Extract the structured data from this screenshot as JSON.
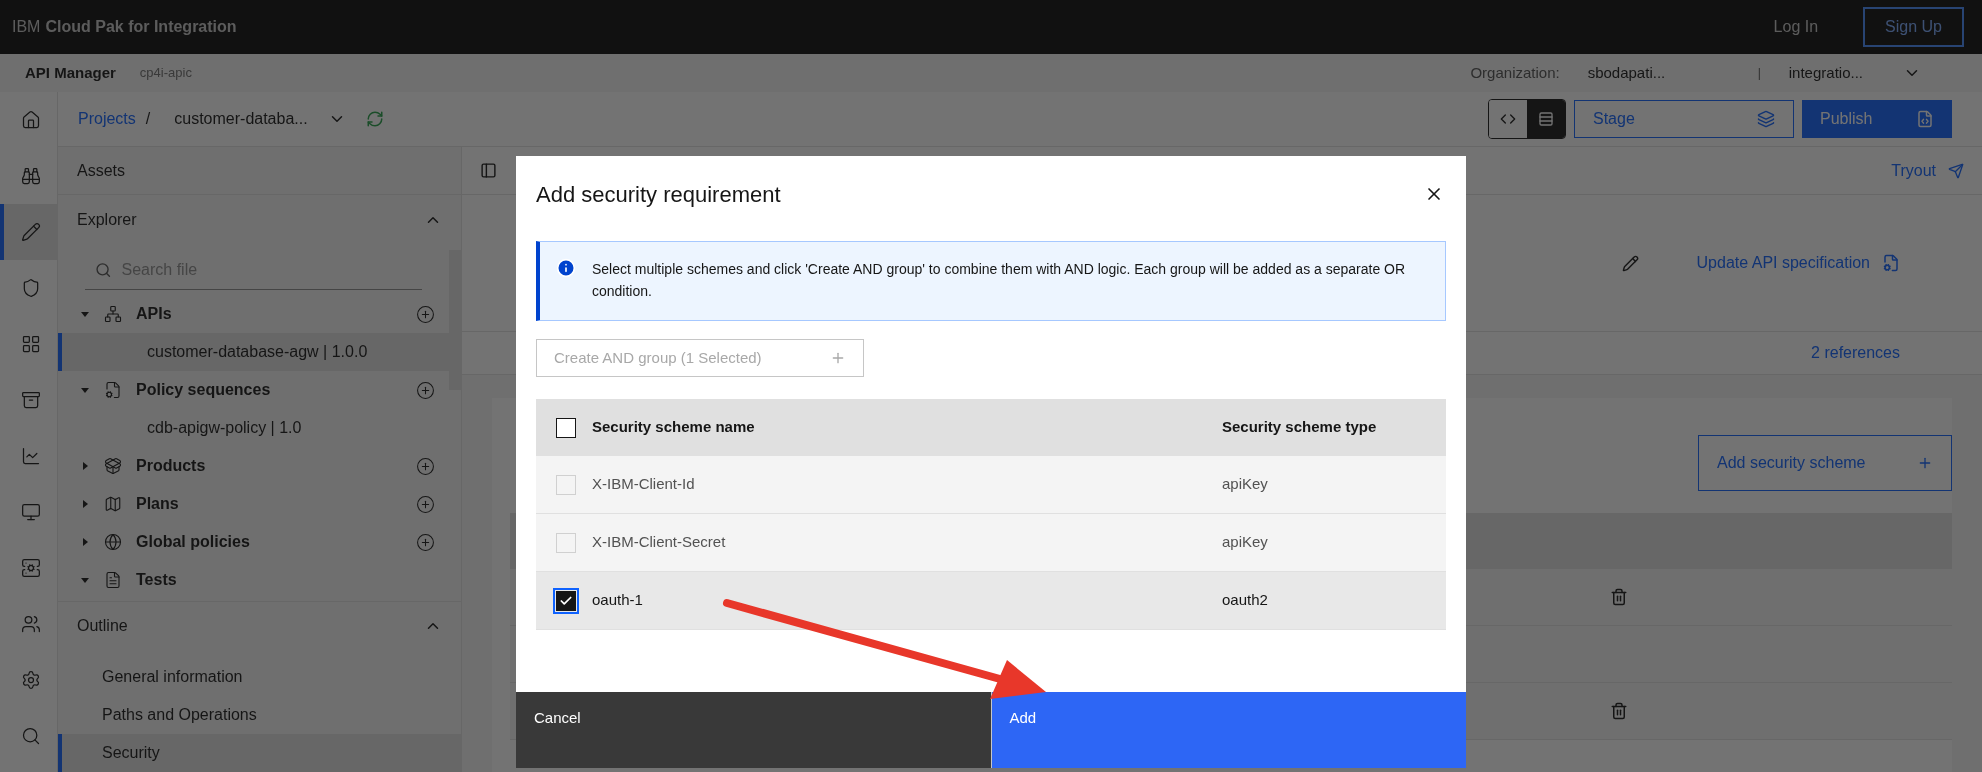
{
  "header": {
    "brand_prefix": "IBM",
    "brand": "Cloud Pak for Integration",
    "login": "Log In",
    "signup": "Sign Up"
  },
  "subheader": {
    "app": "API Manager",
    "instance": "cp4i-apic",
    "org_label": "Organization:",
    "org": "sbodapati...",
    "separator": "|",
    "catalog": "integratio..."
  },
  "rail": [
    {
      "selected": false
    },
    {
      "selected": false
    },
    {
      "selected": true
    },
    {
      "selected": false
    },
    {
      "selected": false
    },
    {
      "selected": false
    },
    {
      "selected": false
    },
    {
      "selected": false
    },
    {
      "selected": false
    },
    {
      "selected": false
    },
    {
      "selected": false
    },
    {
      "selected": false
    }
  ],
  "breadcrumb": {
    "root": "Projects",
    "separator": "/",
    "current": "customer-databa..."
  },
  "toolbar": {
    "view_toggle": [
      {
        "selected": false
      },
      {
        "selected": true
      }
    ],
    "stage": "Stage",
    "publish": "Publish"
  },
  "sidebar": {
    "assets": "Assets",
    "explorer": {
      "title": "Explorer",
      "expanded": true,
      "search_placeholder": "Search file",
      "tree": [
        {
          "label": "APIs",
          "expanded": true,
          "addable": true,
          "children": [
            {
              "label": "customer-database-agw | 1.0.0",
              "selected": true
            }
          ]
        },
        {
          "label": "Policy sequences",
          "expanded": true,
          "addable": true,
          "children": [
            {
              "label": "cdb-apigw-policy | 1.0",
              "selected": false
            }
          ]
        },
        {
          "label": "Products",
          "expanded": false,
          "addable": true
        },
        {
          "label": "Plans",
          "expanded": false,
          "addable": true
        },
        {
          "label": "Global policies",
          "expanded": false,
          "addable": true
        },
        {
          "label": "Tests",
          "expanded": true,
          "addable": false
        }
      ]
    },
    "outline": {
      "title": "Outline",
      "expanded": true,
      "items": [
        {
          "label": "General information",
          "selected": false
        },
        {
          "label": "Paths and Operations",
          "selected": false
        },
        {
          "label": "Security",
          "selected": true
        }
      ]
    }
  },
  "main": {
    "tryout": "Tryout",
    "update_spec": "Update API specification",
    "references": "2 references",
    "add_scheme": "Add security scheme"
  },
  "modal": {
    "title": "Add security requirement",
    "info": "Select multiple schemes and click 'Create AND group' to combine them with AND logic. Each group will be added as a separate OR condition.",
    "create_group": {
      "label": "Create AND group (1 Selected)",
      "disabled": true
    },
    "columns": [
      "Security scheme name",
      "Security scheme type"
    ],
    "select_all_checked": false,
    "rows": [
      {
        "name": "X-IBM-Client-Id",
        "type": "apiKey",
        "checked": false,
        "disabled": true
      },
      {
        "name": "X-IBM-Client-Secret",
        "type": "apiKey",
        "checked": false,
        "disabled": true
      },
      {
        "name": "oauth-1",
        "type": "oauth2",
        "checked": true,
        "disabled": false
      }
    ],
    "cancel": "Cancel",
    "primary": "Add"
  }
}
